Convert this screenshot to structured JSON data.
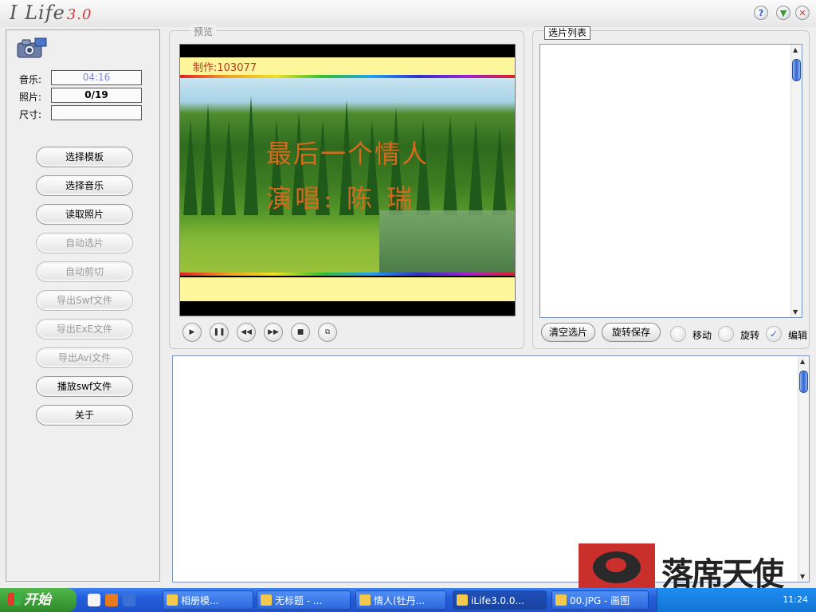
{
  "app": {
    "logo": "I Life",
    "version": "3.0"
  },
  "window_buttons": {
    "help": "?",
    "minimize": "▼",
    "close": "✕"
  },
  "left": {
    "info": [
      {
        "label": "音乐:",
        "value": "04:16"
      },
      {
        "label": "照片:",
        "value": "0/19"
      },
      {
        "label": "尺寸:",
        "value": ""
      }
    ],
    "buttons": [
      {
        "label": "选择模板",
        "enabled": true
      },
      {
        "label": "选择音乐",
        "enabled": true
      },
      {
        "label": "读取照片",
        "enabled": true
      },
      {
        "label": "自动选片",
        "enabled": false
      },
      {
        "label": "自动剪切",
        "enabled": false
      },
      {
        "label": "导出Swf文件",
        "enabled": false
      },
      {
        "label": "导出ExE文件",
        "enabled": false
      },
      {
        "label": "导出Avi文件",
        "enabled": false
      },
      {
        "label": "播放swf文件",
        "enabled": true
      },
      {
        "label": "关于",
        "enabled": true
      }
    ]
  },
  "preview": {
    "title": "预览",
    "credit": "制作:103077",
    "song_title": "最后一个情人",
    "singer": "演唱: 陈 瑞",
    "controls": [
      "play",
      "pause",
      "rewind",
      "forward",
      "stop",
      "zoom"
    ]
  },
  "photo_list": {
    "title": "选片列表",
    "clear_button": "清空选片",
    "rotate_save_button": "旋转保存",
    "options": [
      {
        "label": "移动",
        "checked": false
      },
      {
        "label": "旋转",
        "checked": false
      },
      {
        "label": "编辑",
        "checked": true
      }
    ]
  },
  "taskbar": {
    "start": "开始",
    "tasks": [
      {
        "label": "相册模...",
        "active": false
      },
      {
        "label": "无标题 - ...",
        "active": false
      },
      {
        "label": "情人(牡丹...",
        "active": false
      },
      {
        "label": "iLife3.0.0...",
        "active": true
      },
      {
        "label": "00.JPG - 画图",
        "active": false
      }
    ],
    "clock": "11:24"
  },
  "watermark": {
    "text": "落席天使"
  }
}
